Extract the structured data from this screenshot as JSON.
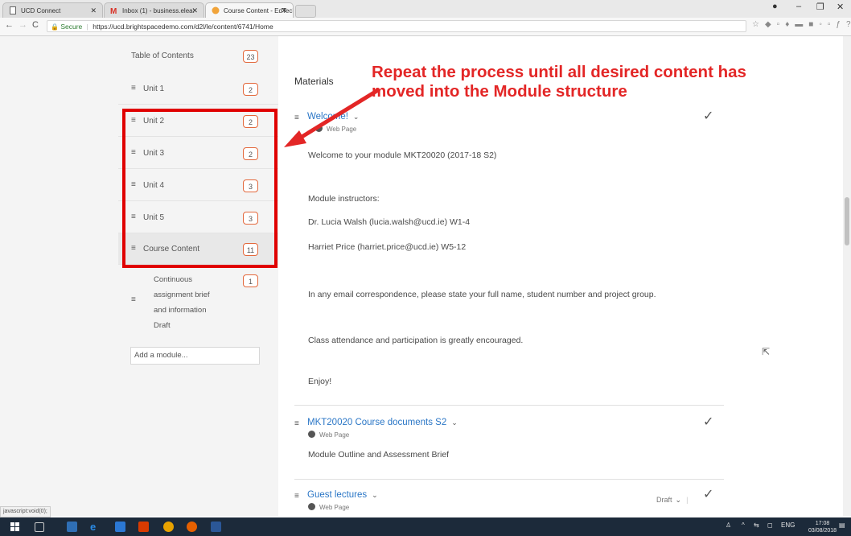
{
  "browser": {
    "tabs": [
      {
        "label": "UCD Connect"
      },
      {
        "label": "Inbox (1) - business.elea:"
      },
      {
        "label": "Course Content - EdTech"
      }
    ],
    "address": {
      "secure_label": "Secure",
      "url": "https://ucd.brightspacedemo.com/d2l/le/content/6741/Home"
    }
  },
  "sidebar": {
    "toc_label": "Table of Contents",
    "toc_count": "23",
    "units": [
      {
        "label": "Unit 1",
        "count": "2"
      },
      {
        "label": "Unit 2",
        "count": "2"
      },
      {
        "label": "Unit 3",
        "count": "2"
      },
      {
        "label": "Unit 4",
        "count": "3"
      },
      {
        "label": "Unit 5",
        "count": "3"
      }
    ],
    "course_content": {
      "label": "Course Content",
      "count": "11"
    },
    "draft_item": {
      "label_lines": [
        "Continuous",
        "assignment brief",
        "and information",
        "Draft"
      ],
      "count": "1"
    },
    "add_module_placeholder": "Add a module..."
  },
  "content": {
    "heading": "Materials",
    "topics": [
      {
        "title": "Welcome!",
        "type": "Web Page"
      },
      {
        "title": "MKT20020 Course documents S2",
        "type": "Web Page"
      },
      {
        "title": "Guest lectures",
        "type": "Web Page",
        "status": "Draft"
      }
    ],
    "welcome_paragraphs": [
      "Welcome to your module MKT20020 (2017-18 S2)",
      "Module instructors:",
      "Dr. Lucia Walsh (lucia.walsh@ucd.ie) W1-4",
      "Harriet Price (harriet.price@ucd.ie) W5-12",
      "In any email correspondence, please state your full name, student number and project group.",
      "Class attendance and participation is greatly encouraged.",
      "Enjoy!"
    ],
    "course_docs_text": "Module Outline and Assessment Brief"
  },
  "annotation": {
    "lines": [
      "Repeat the process until all desired content has",
      "moved into the Module structure"
    ],
    "color": "#e32626"
  },
  "status_bar": "javascript:void(0);",
  "taskbar": {
    "language": "ENG",
    "time": "17:08",
    "date": "03/08/2018"
  }
}
